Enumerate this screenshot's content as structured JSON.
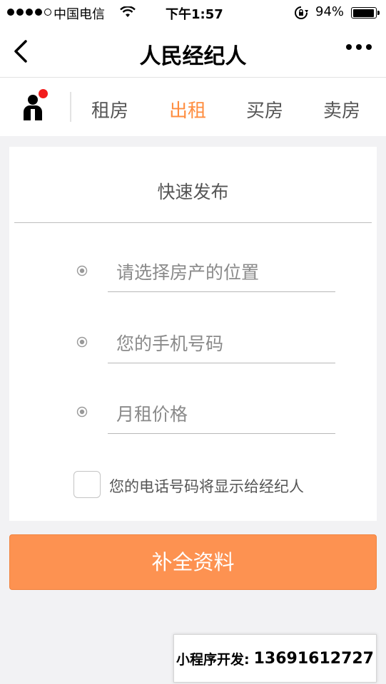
{
  "status_bar": {
    "carrier": "中国电信",
    "time": "下午1:57",
    "battery": "94%",
    "battery_level": 0.94,
    "signal_bars_filled": 4,
    "signal_bars_total": 5
  },
  "nav": {
    "title": "人民经纪人",
    "back_icon": "chevron-left-icon",
    "more_icon": "more-dots-icon"
  },
  "tabs": {
    "items": [
      "租房",
      "出租",
      "买房",
      "卖房"
    ],
    "active_index": 1,
    "active_color": "#ff8d3f",
    "avatar_badge_color": "#f21c1c"
  },
  "form": {
    "title": "快速发布",
    "fields": [
      {
        "placeholder": "请选择房产的位置",
        "value": ""
      },
      {
        "placeholder": "您的手机号码",
        "value": ""
      },
      {
        "placeholder": "月租价格",
        "value": ""
      }
    ],
    "consent_label": "您的电话号码将显示给经纪人",
    "consent_checked": false
  },
  "submit": {
    "label": "补全资料",
    "color": "#fd9251"
  },
  "watermark": {
    "label": "小程序开发:",
    "phone": "13691612727"
  }
}
